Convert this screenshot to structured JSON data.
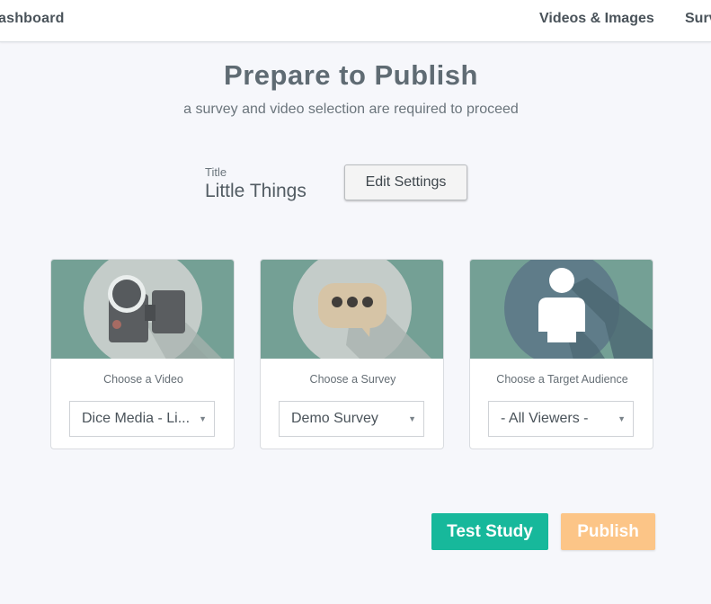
{
  "nav": {
    "left_label": "ashboard",
    "right_items": [
      "Videos & Images",
      "Surv"
    ]
  },
  "header": {
    "title": "Prepare to Publish",
    "subtitle": "a survey and video selection are required to proceed"
  },
  "study": {
    "title_label": "Title",
    "title_value": "Little Things",
    "edit_button": "Edit Settings"
  },
  "cards": [
    {
      "icon": "video-camera-icon",
      "label": "Choose a Video",
      "selected": "Dice Media - Li..."
    },
    {
      "icon": "chat-bubble-icon",
      "label": "Choose a Survey",
      "selected": "Demo Survey"
    },
    {
      "icon": "person-icon",
      "label": "Choose a Target Audience",
      "selected": "- All Viewers -"
    }
  ],
  "actions": {
    "test_label": "Test Study",
    "publish_label": "Publish"
  },
  "colors": {
    "accent_teal": "#17b89b",
    "publish_orange": "#fcc587",
    "card_hero": "#74a095",
    "background": "#f6f7fb"
  }
}
